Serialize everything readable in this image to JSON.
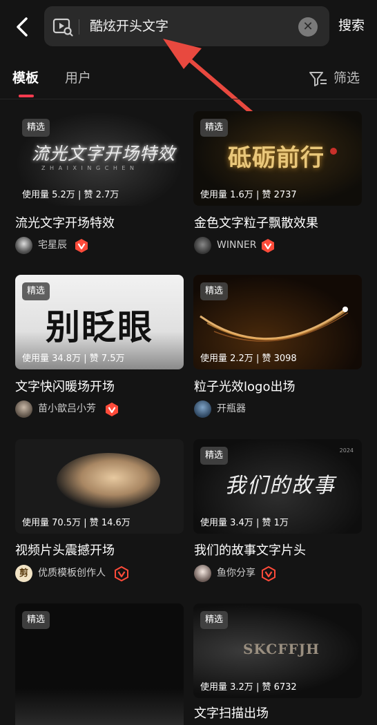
{
  "header": {
    "search_query": "酷炫开头文字",
    "search_button": "搜索"
  },
  "tabs": [
    {
      "label": "模板",
      "active": true
    },
    {
      "label": "用户",
      "active": false
    }
  ],
  "filter_label": "筛选",
  "accent_color": "#ff3b4f",
  "badge_label": "精选",
  "cards": [
    {
      "title": "流光文字开场特效",
      "stats": "使用量 5.2万 | 赞 2.7万",
      "author": "宅星辰",
      "verified": true,
      "thumb_text": "流光文字开场特效",
      "thumb_subtext": "Z H A I X I N G C H E N",
      "featured": true
    },
    {
      "title": "金色文字粒子飘散效果",
      "stats": "使用量 1.6万 | 赞 2737",
      "author": "WINNER",
      "verified": true,
      "thumb_text": "砥砺前行",
      "featured": true
    },
    {
      "title": "文字快闪暖场开场",
      "stats": "使用量 34.8万 | 赞 7.5万",
      "author": "苗小歆吕小芳",
      "verified": true,
      "thumb_text": "别眨眼",
      "featured": true
    },
    {
      "title": "粒子光效logo出场",
      "stats": "使用量 2.2万 | 赞 3098",
      "author": "开瓶器",
      "verified": false,
      "featured": true
    },
    {
      "title": "视频片头震撼开场",
      "stats": "使用量 70.5万 | 赞 14.6万",
      "author": "优质模板创作人",
      "verified": true,
      "author_avatar_text": "剪",
      "featured": false
    },
    {
      "title": "我们的故事文字片头",
      "stats": "使用量 3.4万 | 赞 1万",
      "author": "鱼你分享",
      "verified": true,
      "thumb_text": "我们的故事",
      "thumb_year": "2024",
      "featured": true
    },
    {
      "title": "",
      "stats": "",
      "author": "",
      "verified": false,
      "featured": true
    },
    {
      "title": "文字扫描出场",
      "stats": "使用量 3.2万 | 赞 6732",
      "author": "",
      "verified": false,
      "thumb_text": "SKCFFJH",
      "featured": true
    }
  ]
}
